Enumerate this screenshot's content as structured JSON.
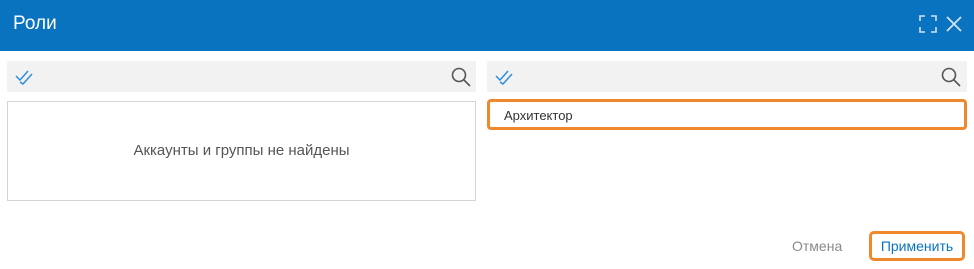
{
  "window": {
    "title": "Роли",
    "maximize_icon": "maximize-icon",
    "close_icon": "close-icon"
  },
  "left_panel": {
    "search": {
      "value": "",
      "placeholder": ""
    },
    "empty_message": "Аккаунты и группы не найдены"
  },
  "right_panel": {
    "search": {
      "value": "",
      "placeholder": ""
    },
    "items": [
      {
        "label": "Архитектор",
        "highlighted": true
      }
    ]
  },
  "footer": {
    "cancel_label": "Отмена",
    "apply_label": "Применить"
  },
  "colors": {
    "titlebar": "#0a73bf",
    "highlight": "#f0892d",
    "accent_text": "#0a73bf"
  }
}
